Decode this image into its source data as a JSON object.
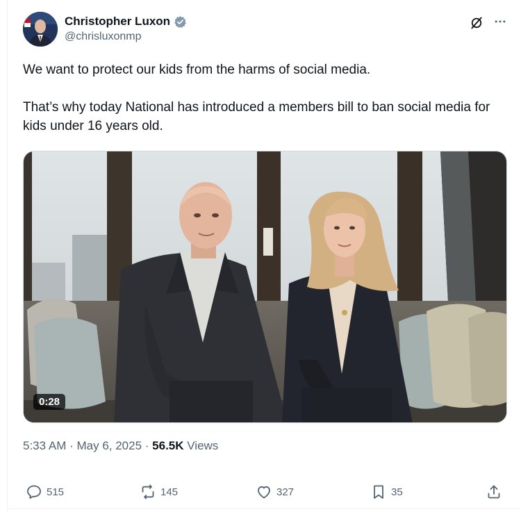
{
  "author": {
    "display_name": "Christopher Luxon",
    "handle": "@chrisluxonmp"
  },
  "tweet": {
    "paragraphs": [
      "We want to protect our kids from the harms of social media.",
      "That’s why today National has introduced a members bill to ban social media for kids under 16 years old."
    ]
  },
  "media": {
    "duration": "0:28"
  },
  "meta": {
    "time": "5:33 AM",
    "sep1": " · ",
    "date": "May 6, 2025",
    "sep2": " · ",
    "views_count": "56.5K",
    "views_label": " Views"
  },
  "actions": {
    "replies": "515",
    "reposts": "145",
    "likes": "327",
    "bookmarks": "35"
  },
  "icons": {
    "verified": "verified-badge-icon",
    "grok": "grok-icon",
    "more": "more-icon",
    "reply": "reply-icon",
    "repost": "repost-icon",
    "like": "heart-icon",
    "bookmark": "bookmark-icon",
    "share": "share-icon"
  },
  "colors": {
    "text": "#0f1419",
    "secondary": "#536471",
    "verified": "#829aab",
    "border": "#cfd9de"
  }
}
